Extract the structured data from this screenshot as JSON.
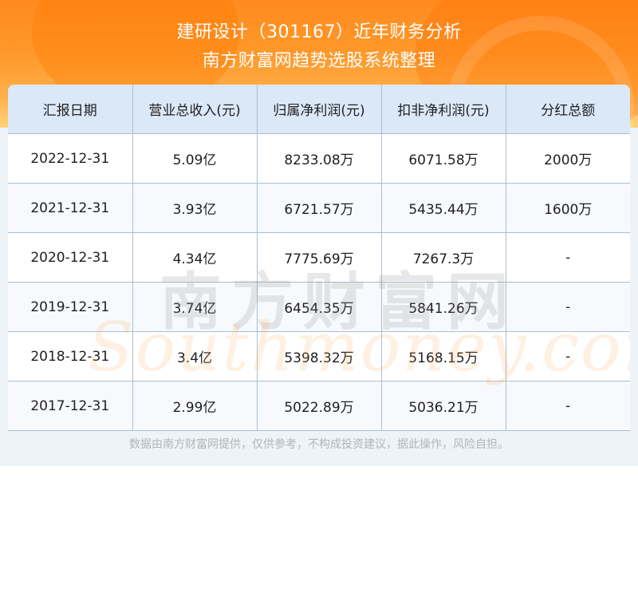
{
  "header": {
    "title_line1": "建研设计（301167）近年财务分析",
    "title_line2": "南方财富网趋势选股系统整理"
  },
  "watermark": {
    "cn": "南方财富网",
    "en": "Southmoney.com"
  },
  "chart_data": {
    "type": "table",
    "columns": [
      "汇报日期",
      "营业总收入(元)",
      "归属净利润(元)",
      "扣非净利润(元)",
      "分红总额"
    ],
    "rows": [
      [
        "2022-12-31",
        "5.09亿",
        "8233.08万",
        "6071.58万",
        "2000万"
      ],
      [
        "2021-12-31",
        "3.93亿",
        "6721.57万",
        "5435.44万",
        "1600万"
      ],
      [
        "2020-12-31",
        "4.34亿",
        "7775.69万",
        "7267.3万",
        "-"
      ],
      [
        "2019-12-31",
        "3.74亿",
        "6454.35万",
        "5841.26万",
        "-"
      ],
      [
        "2018-12-31",
        "3.4亿",
        "5398.32万",
        "5168.15万",
        "-"
      ],
      [
        "2017-12-31",
        "2.99亿",
        "5022.89万",
        "5036.21万",
        "-"
      ]
    ]
  },
  "footer": {
    "disclaimer": "数据由南方财富网提供，仅供参考，不构成投资建议，据此操作，风险自担。"
  }
}
